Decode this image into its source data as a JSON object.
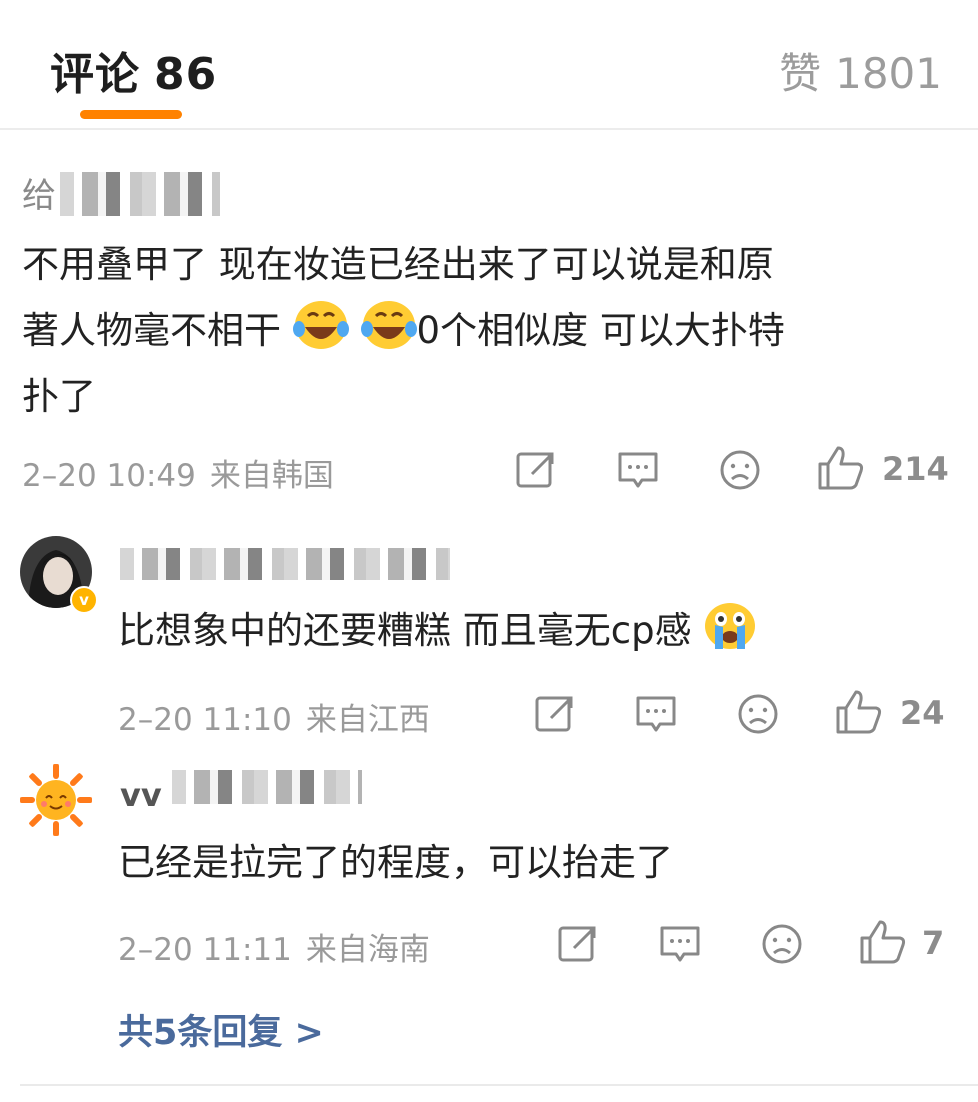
{
  "header": {
    "tab_label": "评论",
    "tab_count": "86",
    "likes_label": "赞",
    "likes_count": "1801"
  },
  "comment": {
    "reply_prefix": "给",
    "lines": [
      "不用叠甲了 现在妆造已经出来了可以说是和原",
      "著人物毫不相干",
      "0个相似度  可以大扑特",
      "扑了"
    ],
    "emojis": [
      "laugh-cry-emoji",
      "laugh-cry-emoji"
    ],
    "time": "2–20 10:49",
    "location": "来自韩国",
    "likes": "214"
  },
  "replies": [
    {
      "text": "比想象中的还要糟糕 而且毫无cp感",
      "emoji": "crying-emoji",
      "time": "2–20 11:10",
      "location": "来自江西",
      "likes": "24",
      "verified": "v"
    },
    {
      "username": "vv",
      "text": "已经是拉完了的程度，可以抬走了",
      "time": "2–20 11:11",
      "location": "来自海南",
      "likes": "7"
    }
  ],
  "more_replies": "共5条回复 >",
  "colors": {
    "accent": "#ff8200",
    "link": "#4a6a9c",
    "muted": "#9a9a9a"
  }
}
